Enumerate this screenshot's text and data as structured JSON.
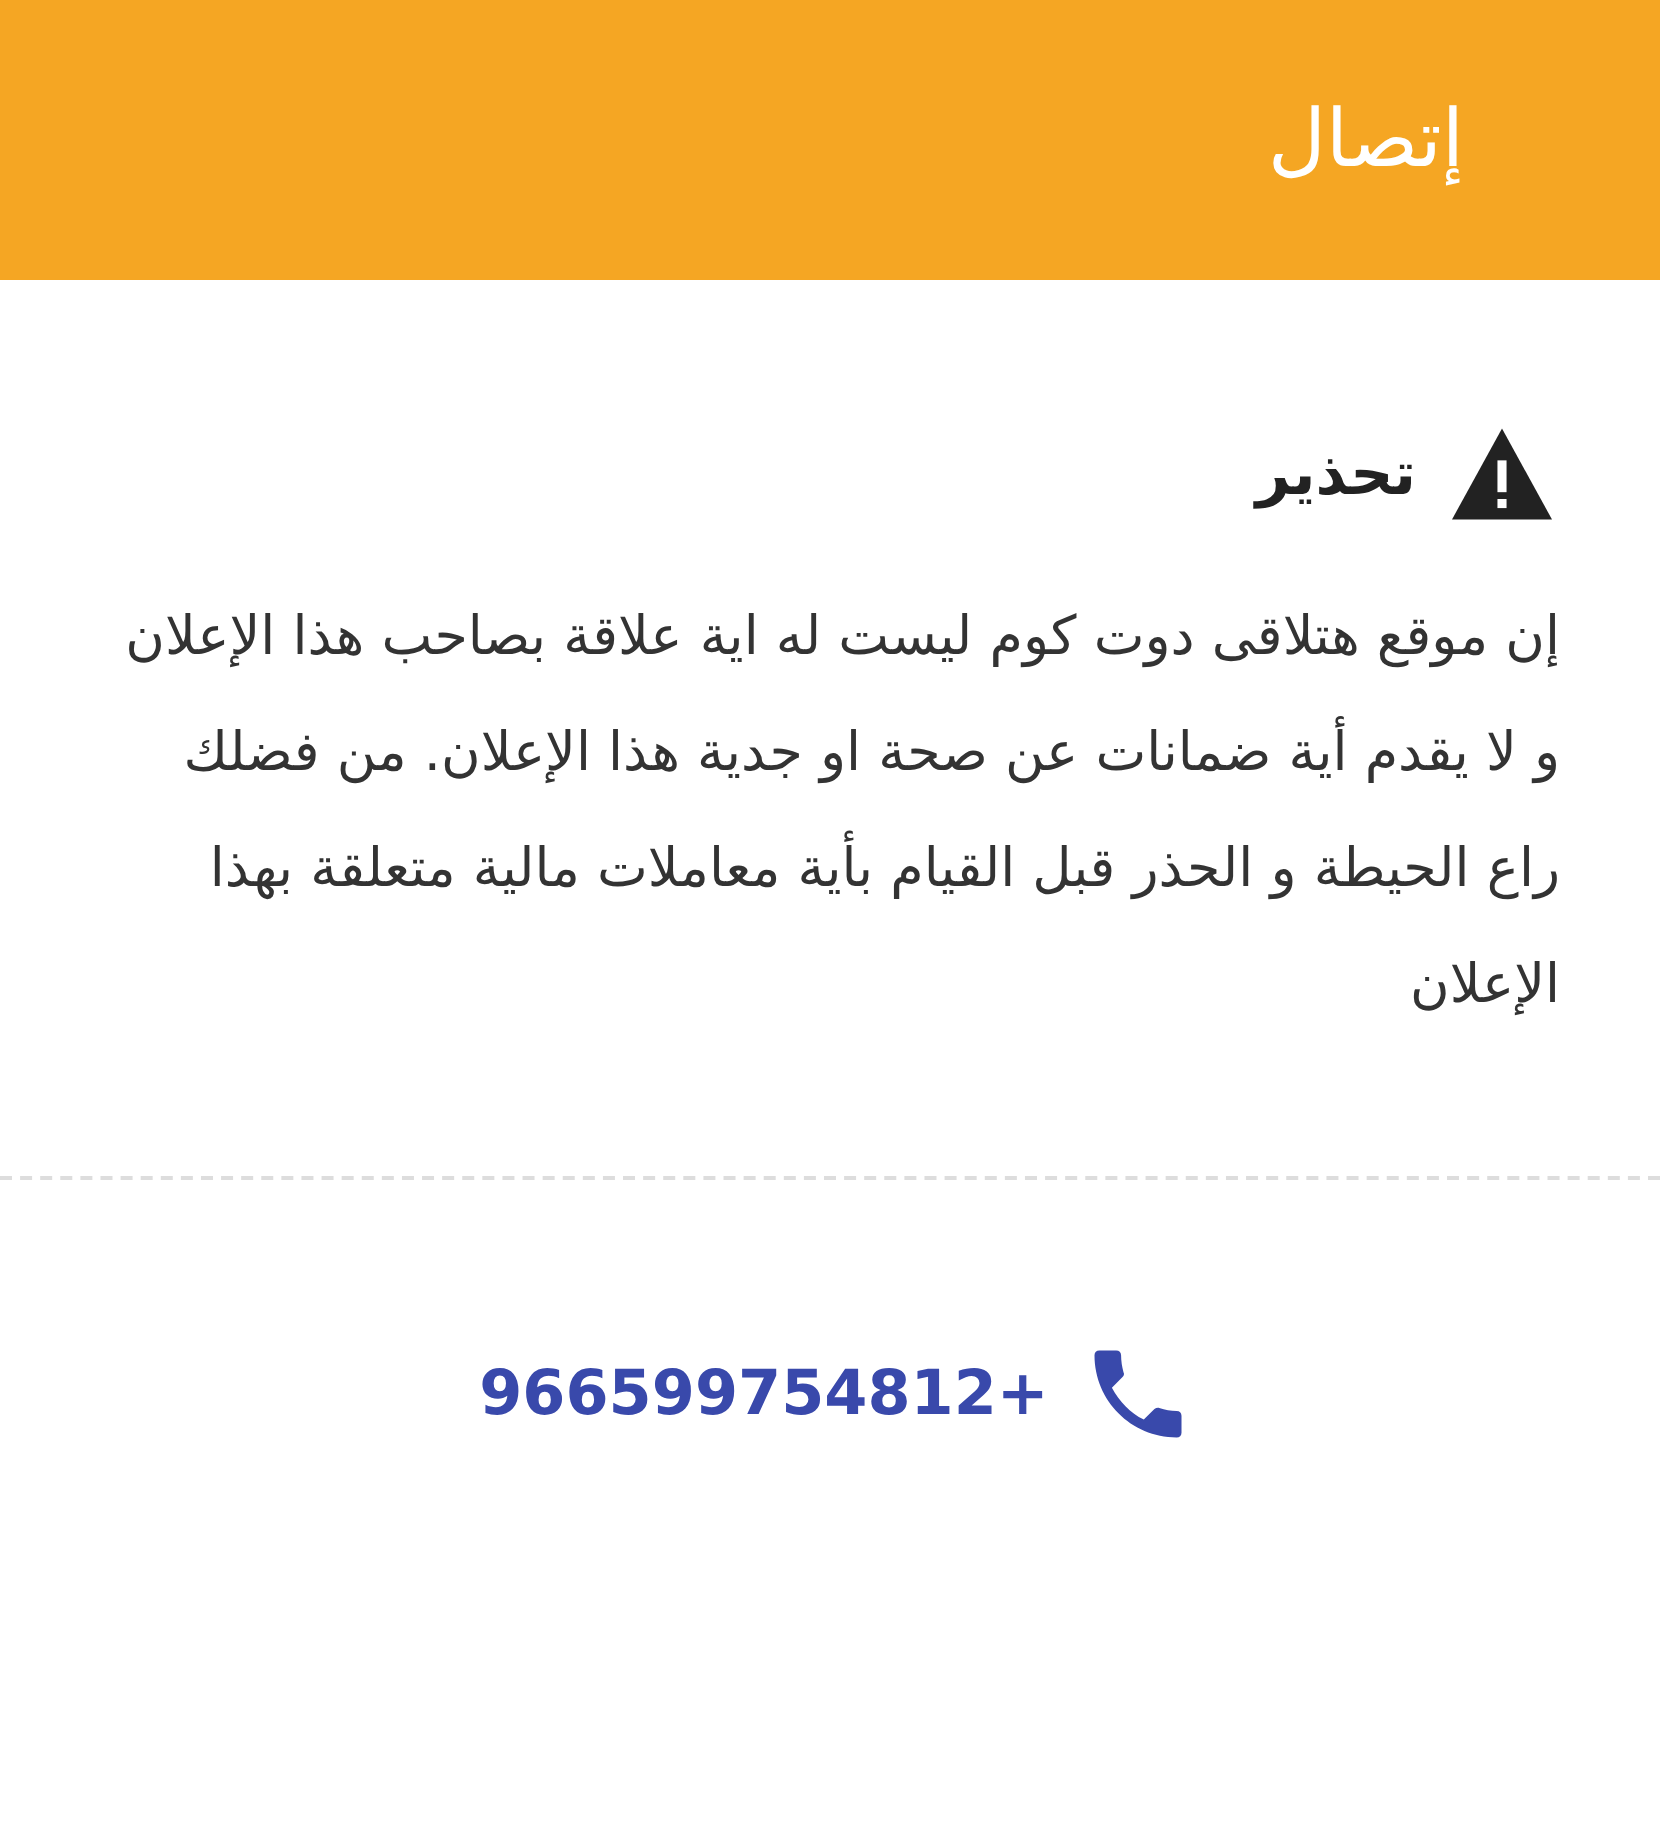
{
  "header": {
    "title": "إتصال"
  },
  "warning": {
    "title": "تحذير",
    "message": "إن موقع هتلاقى دوت كوم ليست له اية علاقة بصاحب هذا الإعلان و لا يقدم أية ضمانات عن صحة او جدية هذا الإعلان. من فضلك راع الحيطة و الحذر قبل القيام بأية معاملات مالية متعلقة بهذا الإعلان"
  },
  "phone": {
    "number": "966599754812+"
  }
}
